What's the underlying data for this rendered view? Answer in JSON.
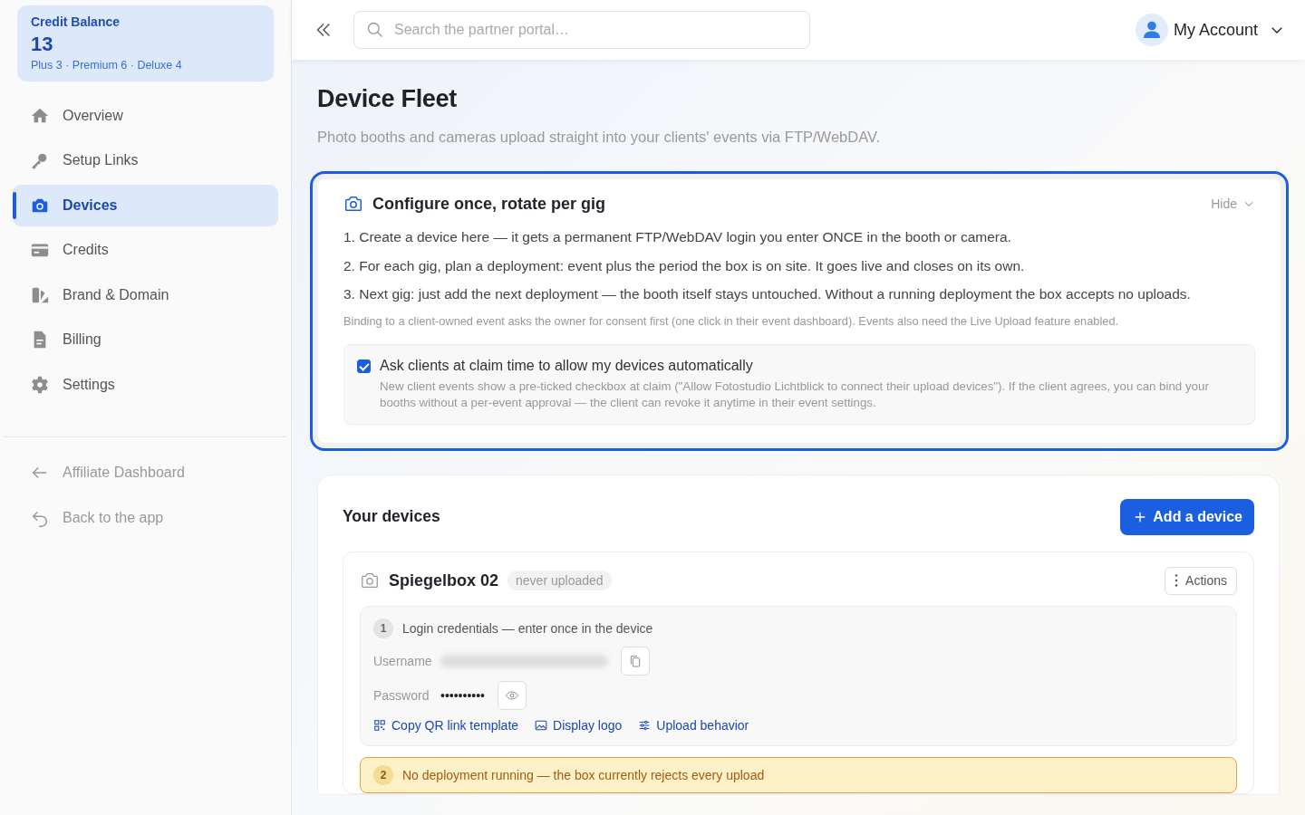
{
  "credit_balance": {
    "label": "Credit Balance",
    "value": "13",
    "breakdown": "Plus 3 · Premium 6 · Deluxe 4"
  },
  "nav": [
    {
      "label": "Overview",
      "kind": "home",
      "selected": false
    },
    {
      "label": "Setup Links",
      "kind": "key",
      "selected": false
    },
    {
      "label": "Devices",
      "kind": "camera",
      "selected": true
    },
    {
      "label": "Credits",
      "kind": "card",
      "selected": false
    },
    {
      "label": "Brand & Domain",
      "kind": "brand",
      "selected": false
    },
    {
      "label": "Billing",
      "kind": "document",
      "selected": false
    },
    {
      "label": "Settings",
      "kind": "gear",
      "selected": false
    }
  ],
  "footer_links": [
    {
      "label": "Affiliate Dashboard",
      "kind": "arrow"
    },
    {
      "label": "Back to the app",
      "kind": "return"
    }
  ],
  "topbar": {
    "search_placeholder": "Search the partner portal…",
    "account": "My Account"
  },
  "page": {
    "title": "Device Fleet",
    "subtitle": "Photo booths and cameras upload straight into your clients' events via FTP/WebDAV."
  },
  "guide": {
    "title": "Configure once, rotate per gig",
    "toggle": "Hide",
    "steps": [
      "1. Create a device here — it gets a permanent FTP/WebDAV login you enter ONCE in the booth or camera.",
      "2. For each gig, plan a deployment: event plus the period the box is on site. It goes live and closes on its own.",
      "3. Next gig: just add the next deployment — the booth itself stays untouched. Without a running deployment the box accepts no uploads."
    ],
    "note": "Binding to a client-owned event asks the owner for consent first (one click in their event dashboard). Events also need the Live Upload feature enabled.",
    "option": {
      "checked": true,
      "label": "Ask clients at claim time to allow my devices automatically",
      "description": "New client events show a pre-ticked checkbox at claim (\"Allow Fotostudio Lichtblick to connect their upload devices\"). If the client agrees, you can bind your booths without a per-event approval — the client can revoke it anytime in their event settings."
    }
  },
  "devices": {
    "title": "Your devices",
    "add_button": "Add a device",
    "items": [
      {
        "name": "Spiegelbox 02",
        "status": "never uploaded",
        "actions": "Actions",
        "credentials": {
          "step": "1",
          "title": "Login credentials — enter once in the device",
          "username_label": "Username",
          "password_label": "Password",
          "password": "••••••••••",
          "links": [
            {
              "label": "Copy QR link template",
              "kind": "qr"
            },
            {
              "label": "Display logo",
              "kind": "image"
            },
            {
              "label": "Upload behavior",
              "kind": "sliders"
            }
          ]
        },
        "warning": {
          "step": "2",
          "text": "No deployment running — the box currently rejects every upload"
        }
      }
    ]
  }
}
